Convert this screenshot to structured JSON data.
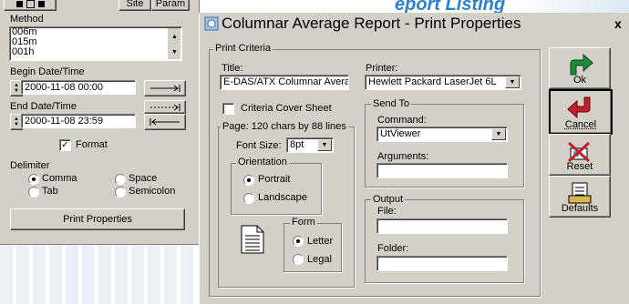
{
  "background": {
    "heading": "eport Listing"
  },
  "left_panel": {
    "site_button": "Site",
    "param_button": "Param",
    "method_label": "Method",
    "methods": [
      "006m",
      "015m",
      "001h"
    ],
    "begin_label": "Begin Date/Time",
    "begin_value": "2000-11-08 00:00",
    "end_label": "End Date/Time",
    "end_value": "2000-11-08 23:59",
    "format_label": "Format",
    "format_checked": true,
    "delimiter_label": "Delimiter",
    "delimiters": {
      "comma": "Comma",
      "space": "Space",
      "tab": "Tab",
      "semicolon": "Semicolon"
    },
    "delimiter_selected": "comma",
    "print_properties_button": "Print Properties"
  },
  "dialog": {
    "title": "Columnar Average Report - Print Properties",
    "close": "x",
    "print_criteria_label": "Print Criteria",
    "title_label": "Title:",
    "title_value": "E-DAS/ATX Columnar Avera",
    "printer_label": "Printer:",
    "printer_value": "Hewlett Packard LaserJet 6L",
    "criteria_cover_label": "Criteria Cover Sheet",
    "page_label": "Page: 120 chars by 88 lines",
    "font_size_label": "Font Size:",
    "font_size_value": "8pt",
    "orientation_label": "Orientation",
    "portrait_label": "Portrait",
    "landscape_label": "Landscape",
    "orientation_selected": "portrait",
    "form_label": "Form",
    "letter_label": "Letter",
    "legal_label": "Legal",
    "form_selected": "letter",
    "send_to_label": "Send To",
    "command_label": "Command:",
    "command_value": "UtViewer",
    "arguments_label": "Arguments:",
    "arguments_value": "",
    "output_label": "Output",
    "file_label": "File:",
    "file_value": "",
    "folder_label": "Folder:",
    "folder_value": "",
    "buttons": {
      "ok": "Ok",
      "cancel": "Cancel",
      "reset": "Reset",
      "defaults": "Defaults"
    },
    "colors": {
      "ok_arrow": "#1e8a3a",
      "cancel_arrow": "#c0202a"
    }
  }
}
